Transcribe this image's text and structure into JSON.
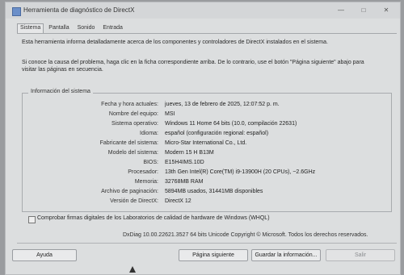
{
  "window": {
    "title": "Herramienta de diagnóstico de DirectX"
  },
  "tabs": [
    "Sistema",
    "Pantalla",
    "Sonido",
    "Entrada"
  ],
  "intro": "Esta herramienta informa detalladamente acerca de los componentes y controladores de DirectX instalados en el sistema.",
  "hint": "Si conoce la causa del problema, haga clic en la ficha correspondiente arriba. De lo contrario, use el botón \"Página siguiente\" abajo para visitar las páginas en secuencia.",
  "system_info": {
    "title": "Información del sistema",
    "rows": [
      {
        "label": "Fecha y hora actuales:",
        "value": "jueves, 13 de febrero de 2025, 12:07:52 p. m."
      },
      {
        "label": "Nombre del equipo:",
        "value": "MSI"
      },
      {
        "label": "Sistema operativo:",
        "value": "Windows 11 Home 64 bits (10.0, compilación 22631)"
      },
      {
        "label": "Idioma:",
        "value": "español (configuración regional: español)"
      },
      {
        "label": "Fabricante del sistema:",
        "value": "Micro-Star International Co., Ltd."
      },
      {
        "label": "Modelo del sistema:",
        "value": "Modern 15 H B13M"
      },
      {
        "label": "BIOS:",
        "value": "E15H4IMS.10D"
      },
      {
        "label": "Procesador:",
        "value": "13th Gen Intel(R) Core(TM) i9-13900H (20 CPUs), ~2.6GHz"
      },
      {
        "label": "Memoria:",
        "value": "32768MB RAM"
      },
      {
        "label": "Archivo de paginación:",
        "value": "5894MB usados, 31441MB disponibles"
      },
      {
        "label": "Versión de DirectX:",
        "value": "DirectX 12"
      }
    ]
  },
  "whql_checkbox": {
    "label": "Comprobar firmas digitales de los Laboratorios de calidad de hardware de Windows (WHQL)"
  },
  "footer": "DxDiag 10.00.22621.3527 64 bits Unicode  Copyright © Microsoft. Todos los derechos reservados.",
  "buttons": {
    "help": "Ayuda",
    "next": "Página siguiente",
    "save": "Guardar la información...",
    "exit": "Salir"
  }
}
